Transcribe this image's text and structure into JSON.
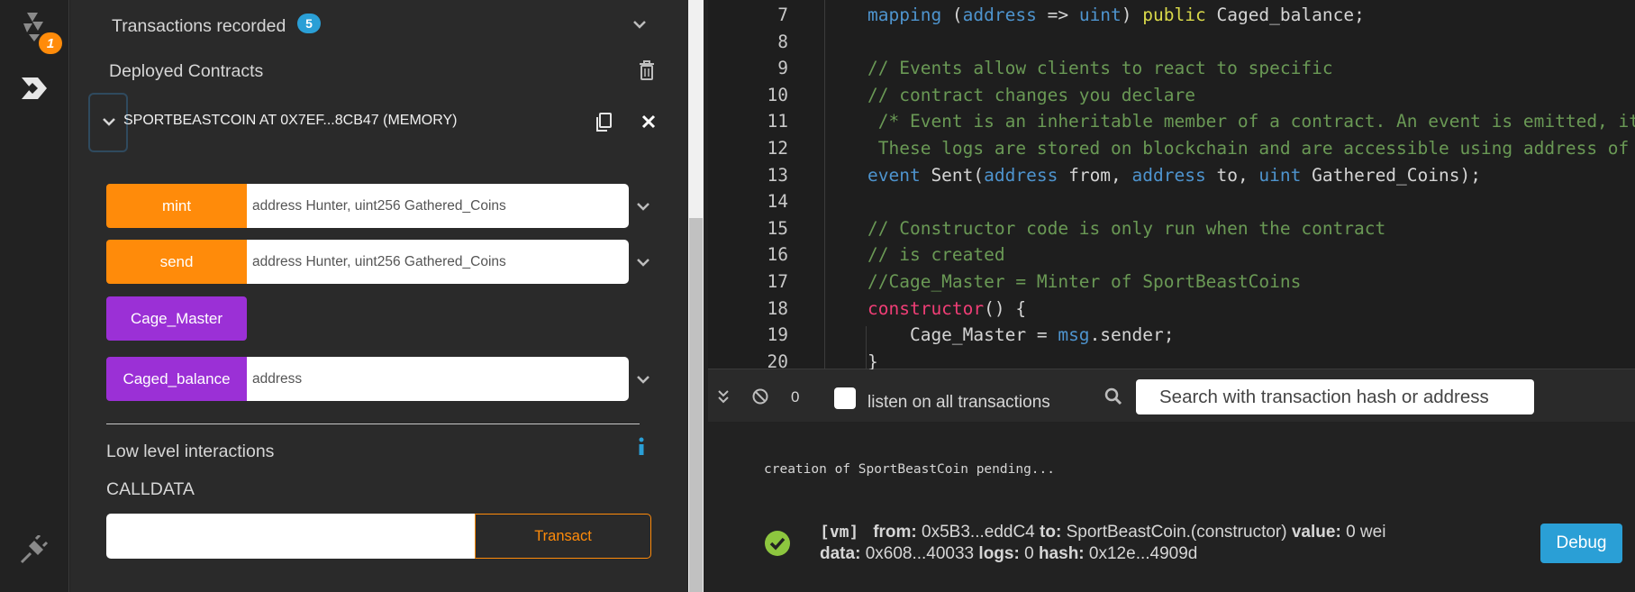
{
  "sidebar": {
    "notification_count": "1"
  },
  "panel": {
    "transactions_label": "Transactions recorded",
    "transactions_count": "5",
    "deployed_label": "Deployed Contracts",
    "contract_title": "SPORTBEASTCOIN AT 0X7EF...8CB47 (MEMORY)",
    "functions": [
      {
        "label": "mint",
        "placeholder": "address Hunter, uint256 Gathered_Coins"
      },
      {
        "label": "send",
        "placeholder": "address Hunter, uint256 Gathered_Coins"
      },
      {
        "label": "Cage_Master"
      },
      {
        "label": "Caged_balance",
        "placeholder": "address"
      }
    ],
    "low_level_label": "Low level interactions",
    "calldata_label": "CALLDATA",
    "transact_label": "Transact",
    "colors": {
      "payable": "#ff8b0a",
      "view": "#9b30d6"
    }
  },
  "editor": {
    "line_numbers": [
      "7",
      "8",
      "9",
      "10",
      "11",
      "12",
      "13",
      "14",
      "15",
      "16",
      "17",
      "18",
      "19",
      "20"
    ],
    "lines": {
      "l7": [
        "mapping",
        " (",
        "address",
        " => ",
        "uint",
        ") ",
        "public",
        " Caged_balance;"
      ],
      "l9": "// Events allow clients to react to specific",
      "l10": "// contract changes you declare",
      "l11": " /* Event is an inheritable member of a contract. An event is emitted, it sto",
      "l12": " These logs are stored on blockchain and are accessible using address of t",
      "l13": [
        "event",
        " Sent(",
        "address",
        " from, ",
        "address",
        " to, ",
        "uint",
        " Gathered_Coins);"
      ],
      "l15": "// Constructor code is only run when the contract",
      "l16": "// is created",
      "l17": "//Cage_Master = Minter of SportBeastCoins",
      "l18": [
        "constructor",
        "() {"
      ],
      "l19": [
        "    Cage_Master = ",
        "msg",
        ".sender;"
      ],
      "l20": "}"
    }
  },
  "terminal": {
    "count": "0",
    "listen_label": "listen on all transactions",
    "search_placeholder": "Search with transaction hash or address",
    "pending_text": "creation of SportBeastCoin pending...",
    "tx": {
      "vm": "[vm]",
      "from_k": "from:",
      "from_v": "0x5B3...eddC4",
      "to_k": "to:",
      "to_v": "SportBeastCoin.(constructor)",
      "value_k": "value:",
      "value_v": "0 wei",
      "data_k": "data:",
      "data_v": "0x608...40033",
      "logs_k": "logs:",
      "logs_v": "0",
      "hash_k": "hash:",
      "hash_v": "0x12e...4909d"
    },
    "debug_label": "Debug"
  }
}
